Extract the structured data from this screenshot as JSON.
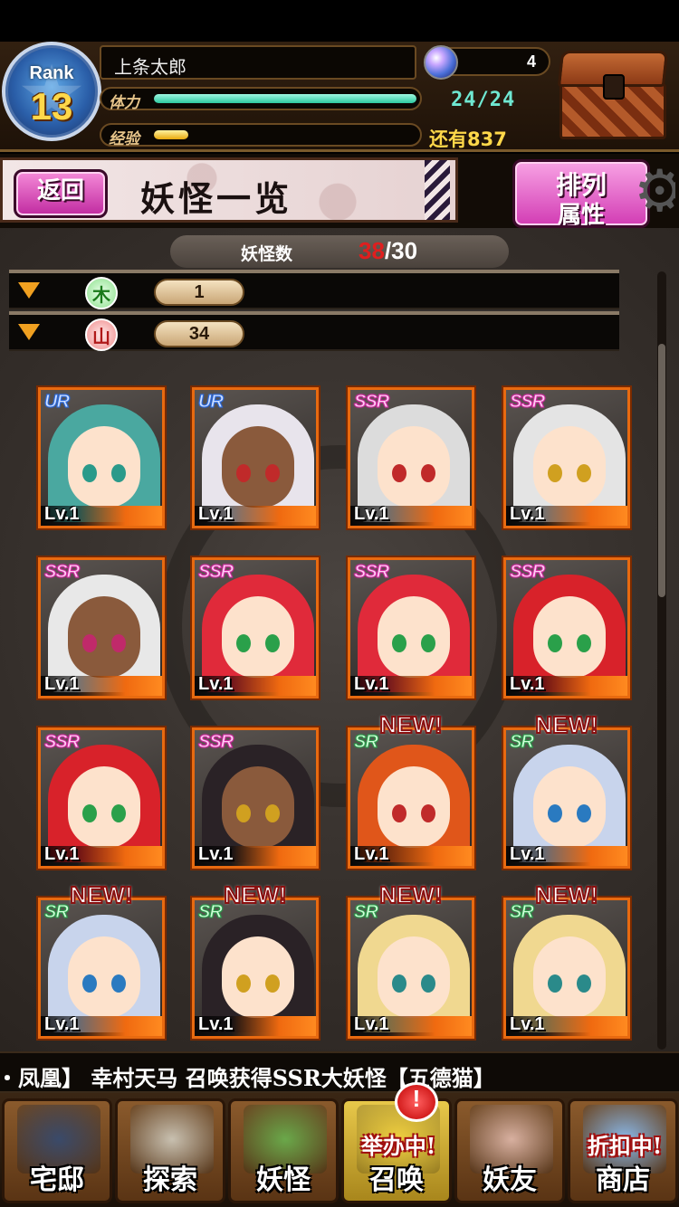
{
  "player": {
    "rank_label": "Rank",
    "rank": "13",
    "name": "上条太郎",
    "stamina_label": "体力",
    "stamina_value": "24/24",
    "stamina_fraction": 1.0,
    "exp_label": "经验",
    "exp_remaining": "还有837",
    "exp_fraction": 0.13,
    "gems": "4"
  },
  "title_bar": {
    "back_label": "返回",
    "title": "妖怪一览",
    "sort_line1": "排列",
    "sort_line2": "属性"
  },
  "count": {
    "label": "妖怪数",
    "current": "38",
    "max": "/30"
  },
  "filters": [
    {
      "element": "木",
      "value": "1"
    },
    {
      "element": "山",
      "value": "34"
    }
  ],
  "cards": [
    {
      "rarity": "UR",
      "level": "Lv.1",
      "new": false,
      "hair": "#4aa8a0",
      "skin": "#fde2cc",
      "eye": "#2a9a8a"
    },
    {
      "rarity": "UR",
      "level": "Lv.1",
      "new": false,
      "hair": "#e8e4ec",
      "skin": "#8a5a3c",
      "eye": "#c02a2a"
    },
    {
      "rarity": "SSR",
      "level": "Lv.1",
      "new": false,
      "hair": "#dcdcdc",
      "skin": "#fde2cc",
      "eye": "#c02a2a"
    },
    {
      "rarity": "SSR",
      "level": "Lv.1",
      "new": false,
      "hair": "#e4e4e4",
      "skin": "#fde2cc",
      "eye": "#d0a020"
    },
    {
      "rarity": "SSR",
      "level": "Lv.1",
      "new": false,
      "hair": "#e8e8e8",
      "skin": "#8a5a3c",
      "eye": "#c02a6a"
    },
    {
      "rarity": "SSR",
      "level": "Lv.1",
      "new": false,
      "hair": "#e02a3a",
      "skin": "#fde2cc",
      "eye": "#2aa04a"
    },
    {
      "rarity": "SSR",
      "level": "Lv.1",
      "new": false,
      "hair": "#e02a3a",
      "skin": "#fde2cc",
      "eye": "#2aa04a"
    },
    {
      "rarity": "SSR",
      "level": "Lv.1",
      "new": false,
      "hair": "#d8222a",
      "skin": "#fde2cc",
      "eye": "#2aa04a"
    },
    {
      "rarity": "SSR",
      "level": "Lv.1",
      "new": false,
      "hair": "#d8222a",
      "skin": "#fde2cc",
      "eye": "#2aa04a"
    },
    {
      "rarity": "SSR",
      "level": "Lv.1",
      "new": false,
      "hair": "#2a2226",
      "skin": "#8a5a3c",
      "eye": "#d0a020"
    },
    {
      "rarity": "SR",
      "level": "Lv.1",
      "new": true,
      "hair": "#e0561a",
      "skin": "#fde2cc",
      "eye": "#c02a2a"
    },
    {
      "rarity": "SR",
      "level": "Lv.1",
      "new": true,
      "hair": "#c8d4ec",
      "skin": "#fde2cc",
      "eye": "#2a7ac0"
    },
    {
      "rarity": "SR",
      "level": "Lv.1",
      "new": true,
      "hair": "#c8d4ec",
      "skin": "#fde2cc",
      "eye": "#2a7ac0"
    },
    {
      "rarity": "SR",
      "level": "Lv.1",
      "new": true,
      "hair": "#2a2226",
      "skin": "#fde2cc",
      "eye": "#d0a020"
    },
    {
      "rarity": "SR",
      "level": "Lv.1",
      "new": true,
      "hair": "#f0d890",
      "skin": "#fde2cc",
      "eye": "#2a8a8a"
    },
    {
      "rarity": "SR",
      "level": "Lv.1",
      "new": true,
      "hair": "#f0d890",
      "skin": "#fde2cc",
      "eye": "#2a8a8a"
    }
  ],
  "new_label": "NEW!",
  "ticker": "・凤凰】  幸村天马 召唤获得SSR大妖怪【五德猫】",
  "nav": [
    {
      "label": "宅邸",
      "icon": "house-icon",
      "tag": ""
    },
    {
      "label": "探索",
      "icon": "magnifier-icon",
      "tag": ""
    },
    {
      "label": "妖怪",
      "icon": "scroll-icon",
      "tag": ""
    },
    {
      "label": "召唤",
      "icon": "summon-icon",
      "tag": "举办中!"
    },
    {
      "label": "妖友",
      "icon": "friend-icon",
      "tag": ""
    },
    {
      "label": "商店",
      "icon": "shop-orb-icon",
      "tag": "折扣中!"
    }
  ],
  "nav_badge": "!"
}
